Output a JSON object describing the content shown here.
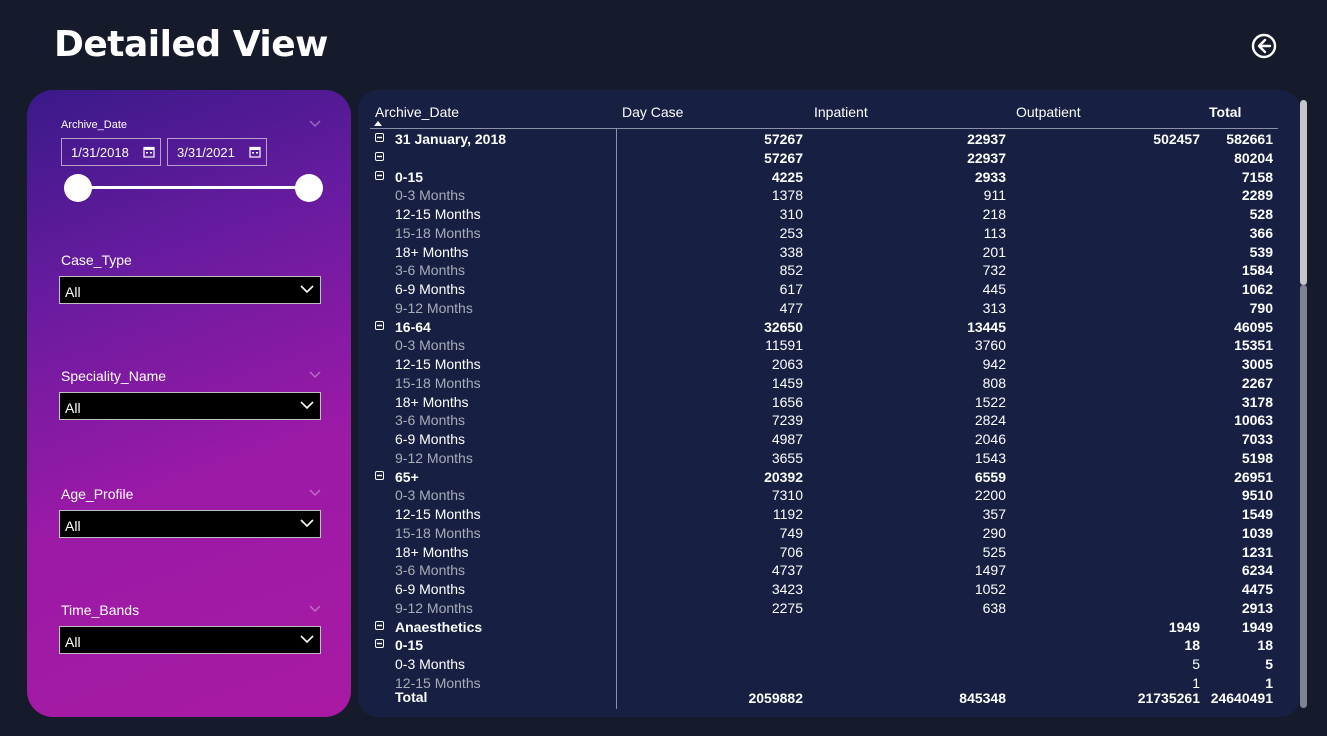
{
  "page_title": "Detailed View",
  "back_button_icon": "back-arrow-circle-icon",
  "filters": {
    "archive_date": {
      "label": "Archive_Date",
      "start": "1/31/2018",
      "end": "3/31/2021"
    },
    "case_type": {
      "label": "Case_Type",
      "value": "All"
    },
    "speciality_name": {
      "label": "Speciality_Name",
      "value": "All"
    },
    "age_profile": {
      "label": "Age_Profile",
      "value": "All"
    },
    "time_bands": {
      "label": "Time_Bands",
      "value": "All"
    }
  },
  "matrix": {
    "headers": {
      "archive_date": "Archive_Date",
      "day_case": "Day Case",
      "inpatient": "Inpatient",
      "outpatient": "Outpatient",
      "total": "Total"
    },
    "rows": [
      {
        "label": "31 January, 2018",
        "day": "57267",
        "in": "22937",
        "out": "502457",
        "tot": "582661",
        "style": "bold",
        "exp": true
      },
      {
        "label": "",
        "day": "57267",
        "in": "22937",
        "out": "",
        "tot": "80204",
        "style": "bold",
        "exp": true
      },
      {
        "label": "0-15",
        "day": "4225",
        "in": "2933",
        "out": "",
        "tot": "7158",
        "style": "bold",
        "exp": true
      },
      {
        "label": "0-3 Months",
        "day": "1378",
        "in": "911",
        "out": "",
        "tot": "2289",
        "style": "dim"
      },
      {
        "label": "12-15 Months",
        "day": "310",
        "in": "218",
        "out": "",
        "tot": "528",
        "style": "normal"
      },
      {
        "label": "15-18 Months",
        "day": "253",
        "in": "113",
        "out": "",
        "tot": "366",
        "style": "dim"
      },
      {
        "label": "18+ Months",
        "day": "338",
        "in": "201",
        "out": "",
        "tot": "539",
        "style": "normal"
      },
      {
        "label": "3-6 Months",
        "day": "852",
        "in": "732",
        "out": "",
        "tot": "1584",
        "style": "dim"
      },
      {
        "label": "6-9 Months",
        "day": "617",
        "in": "445",
        "out": "",
        "tot": "1062",
        "style": "normal"
      },
      {
        "label": "9-12 Months",
        "day": "477",
        "in": "313",
        "out": "",
        "tot": "790",
        "style": "dim"
      },
      {
        "label": "16-64",
        "day": "32650",
        "in": "13445",
        "out": "",
        "tot": "46095",
        "style": "bold",
        "exp": true
      },
      {
        "label": "0-3 Months",
        "day": "11591",
        "in": "3760",
        "out": "",
        "tot": "15351",
        "style": "dim"
      },
      {
        "label": "12-15 Months",
        "day": "2063",
        "in": "942",
        "out": "",
        "tot": "3005",
        "style": "normal"
      },
      {
        "label": "15-18 Months",
        "day": "1459",
        "in": "808",
        "out": "",
        "tot": "2267",
        "style": "dim"
      },
      {
        "label": "18+ Months",
        "day": "1656",
        "in": "1522",
        "out": "",
        "tot": "3178",
        "style": "normal"
      },
      {
        "label": "3-6 Months",
        "day": "7239",
        "in": "2824",
        "out": "",
        "tot": "10063",
        "style": "dim"
      },
      {
        "label": "6-9 Months",
        "day": "4987",
        "in": "2046",
        "out": "",
        "tot": "7033",
        "style": "normal"
      },
      {
        "label": "9-12 Months",
        "day": "3655",
        "in": "1543",
        "out": "",
        "tot": "5198",
        "style": "dim"
      },
      {
        "label": "65+",
        "day": "20392",
        "in": "6559",
        "out": "",
        "tot": "26951",
        "style": "bold",
        "exp": true
      },
      {
        "label": "0-3 Months",
        "day": "7310",
        "in": "2200",
        "out": "",
        "tot": "9510",
        "style": "dim"
      },
      {
        "label": "12-15 Months",
        "day": "1192",
        "in": "357",
        "out": "",
        "tot": "1549",
        "style": "normal"
      },
      {
        "label": "15-18 Months",
        "day": "749",
        "in": "290",
        "out": "",
        "tot": "1039",
        "style": "dim"
      },
      {
        "label": "18+ Months",
        "day": "706",
        "in": "525",
        "out": "",
        "tot": "1231",
        "style": "normal"
      },
      {
        "label": "3-6 Months",
        "day": "4737",
        "in": "1497",
        "out": "",
        "tot": "6234",
        "style": "dim"
      },
      {
        "label": "6-9 Months",
        "day": "3423",
        "in": "1052",
        "out": "",
        "tot": "4475",
        "style": "normal"
      },
      {
        "label": "9-12 Months",
        "day": "2275",
        "in": "638",
        "out": "",
        "tot": "2913",
        "style": "dim"
      },
      {
        "label": "Anaesthetics",
        "day": "",
        "in": "",
        "out": "1949",
        "tot": "1949",
        "style": "bold",
        "exp": true
      },
      {
        "label": "0-15",
        "day": "",
        "in": "",
        "out": "18",
        "tot": "18",
        "style": "bold",
        "exp": true
      },
      {
        "label": "0-3 Months",
        "day": "",
        "in": "",
        "out": "5",
        "tot": "5",
        "style": "normal"
      },
      {
        "label": "12-15 Months",
        "day": "",
        "in": "",
        "out": "1",
        "tot": "1",
        "style": "dim"
      }
    ],
    "total_row": {
      "label": "Total",
      "day": "2059882",
      "in": "845348",
      "out": "21735261",
      "tot": "24640491"
    }
  }
}
